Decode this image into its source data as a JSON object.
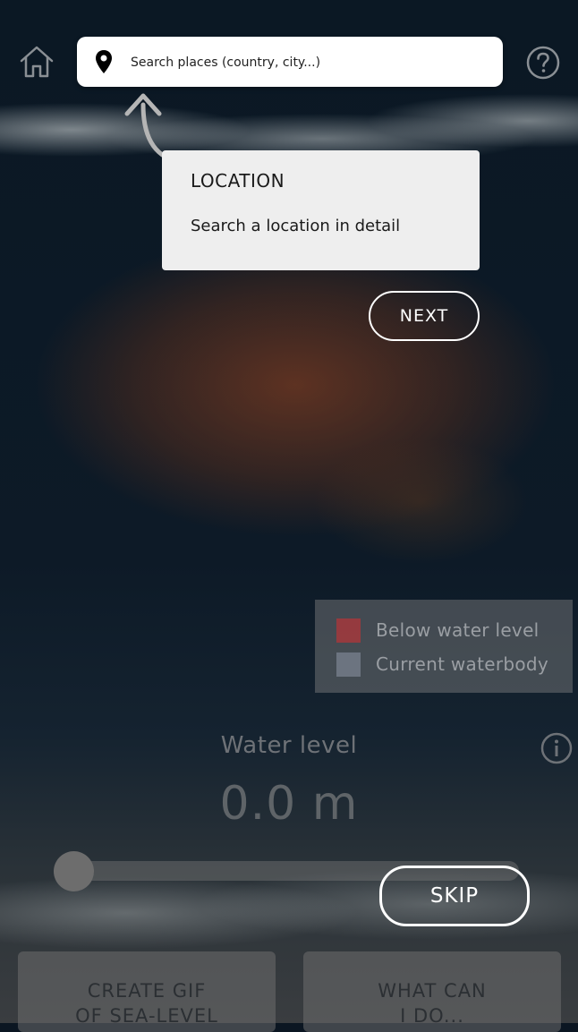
{
  "header": {
    "home_icon": "home-icon",
    "help_icon": "question-circle-icon",
    "search": {
      "placeholder": "Search places (country, city...)",
      "value": "",
      "icon": "map-pin-icon"
    }
  },
  "tutorial": {
    "title": "LOCATION",
    "text": "Search a location in detail",
    "next_label": "NEXT",
    "skip_label": "SKIP"
  },
  "legend": {
    "items": [
      {
        "label": "Below water level",
        "color": "#b0353a"
      },
      {
        "label": "Current waterbody",
        "color": "#8e96a5"
      }
    ]
  },
  "water_level": {
    "label": "Water level",
    "value": "0.0 m",
    "slider_fraction": 0,
    "info_icon": "info-icon"
  },
  "actions": {
    "gif_line1": "CREATE GIF",
    "gif_line2": "OF SEA-LEVEL",
    "todo_line1": "WHAT CAN",
    "todo_line2": "I DO..."
  }
}
